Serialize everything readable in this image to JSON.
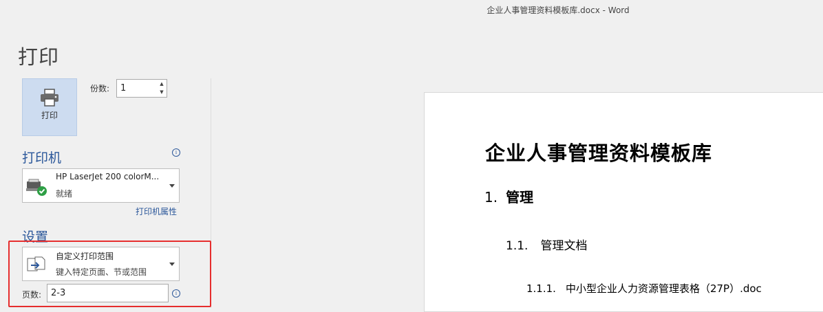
{
  "window": {
    "title": "企业人事管理资料模板库.docx - Word"
  },
  "backstage": {
    "page_title": "打印",
    "print_button_label": "打印",
    "copies": {
      "label": "份数:",
      "value": "1"
    },
    "printer": {
      "heading": "打印机",
      "name": "HP LaserJet 200 colorM...",
      "status": "就绪",
      "properties_link": "打印机属性"
    },
    "settings": {
      "heading": "设置",
      "range": {
        "main": "自定义打印范围",
        "sub": "键入特定页面、节或范围"
      },
      "pages_label": "页数:",
      "pages_value": "2-3"
    }
  },
  "preview": {
    "title": "企业人事管理资料模板库",
    "h1_num": "1.",
    "h1_text": "管理",
    "h2_num": "1.1.",
    "h2_text": "管理文档",
    "h3_num": "1.1.1.",
    "h3_text": "中小型企业人力资源管理表格（27P）.doc"
  },
  "colors": {
    "accent": "#2b579a",
    "highlight": "#e62d2d",
    "selected_bg": "#cddcf0"
  }
}
